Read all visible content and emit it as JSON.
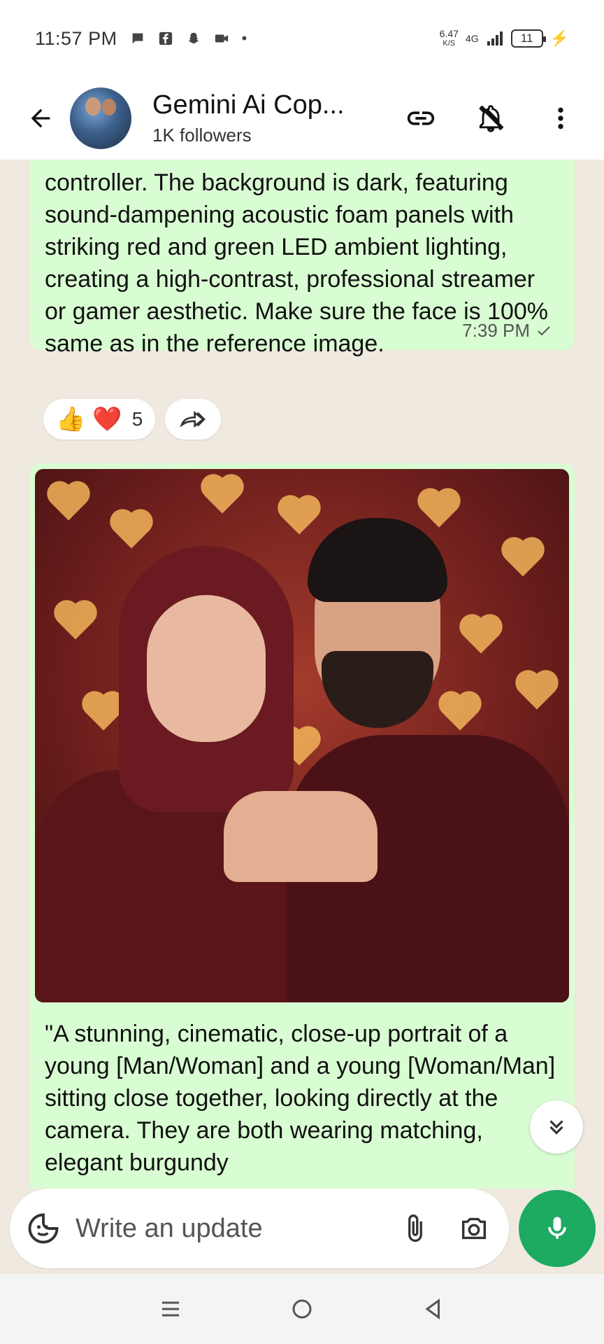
{
  "status_bar": {
    "time": "11:57 PM",
    "network_speed": "6.47",
    "network_speed_unit": "K/S",
    "network_type": "4G",
    "battery": "11"
  },
  "header": {
    "channel_name": "Gemini Ai Cop...",
    "followers": "1K followers"
  },
  "messages": [
    {
      "text": "controller. The background is dark, featuring sound-dampening acoustic foam panels with striking red and green LED ambient lighting, creating a high-contrast, professional streamer or gamer aesthetic. Make sure the face is 100% same as in the reference image.",
      "time": "7:39 PM",
      "reaction_count": "5"
    },
    {
      "text": "\"A stunning, cinematic, close-up portrait of a young [Man/Woman] and a young [Woman/Man] sitting close together, looking directly at the camera. They are both wearing matching, elegant burgundy"
    }
  ],
  "composer": {
    "placeholder": "Write an update"
  },
  "colors": {
    "bubble": "#d9fdd3",
    "accent_green": "#1daa61",
    "background": "#efe9df"
  }
}
